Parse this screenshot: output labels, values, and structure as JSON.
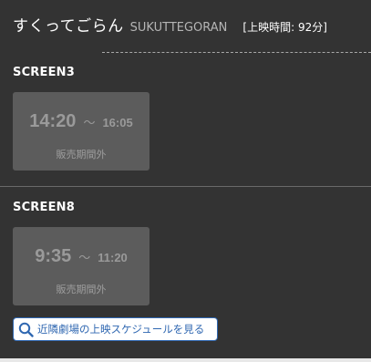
{
  "movie": {
    "title": "すくってごらん",
    "title_en": "SUKUTTEGORAN",
    "runtime": "[上映時間: 92分]"
  },
  "screens": [
    {
      "name": "SCREEN3",
      "showtimes": [
        {
          "start": "14:20",
          "tilde": "～",
          "end": "16:05",
          "status": "販売期間外"
        }
      ]
    },
    {
      "name": "SCREEN8",
      "showtimes": [
        {
          "start": "9:35",
          "tilde": "～",
          "end": "11:20",
          "status": "販売期間外"
        }
      ]
    }
  ],
  "nearby": {
    "label": "近隣劇場の上映スケジュールを見る",
    "icon": "search-icon"
  },
  "colors": {
    "background": "#333333",
    "card": "#5c5c5c",
    "card_text": "#9a9a9a",
    "link_blue": "#2f67b1",
    "bottom_rule": "#e8e8e8"
  }
}
